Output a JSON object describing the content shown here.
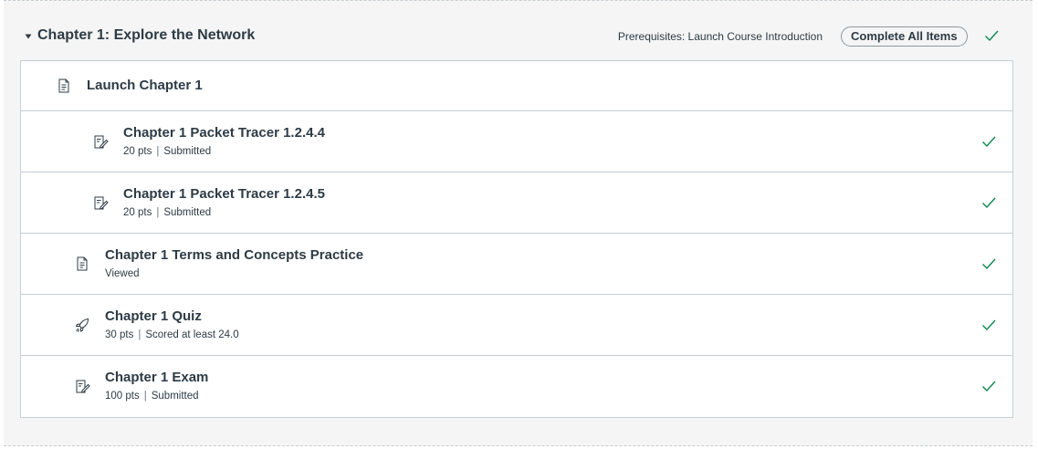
{
  "module": {
    "title": "Chapter 1: Explore the Network",
    "prerequisites": "Prerequisites: Launch Course Introduction",
    "complete_all_label": "Complete All Items",
    "completed": true,
    "accent_color": "#0b874b"
  },
  "items": [
    {
      "title": "Launch Chapter 1",
      "type": "page-icon",
      "indent": 0,
      "is_header": true
    },
    {
      "title": "Chapter 1 Packet Tracer 1.2.4.4",
      "type": "assignment-icon",
      "indent": 2,
      "points": "20 pts",
      "status": "Submitted",
      "completed": true
    },
    {
      "title": "Chapter 1 Packet Tracer 1.2.4.5",
      "type": "assignment-icon",
      "indent": 2,
      "points": "20 pts",
      "status": "Submitted",
      "completed": true
    },
    {
      "title": "Chapter 1 Terms and Concepts Practice",
      "type": "page-icon",
      "indent": 1,
      "points": "",
      "status": "Viewed",
      "completed": true
    },
    {
      "title": "Chapter 1 Quiz",
      "type": "quiz-rocket-icon",
      "indent": 1,
      "points": "30 pts",
      "status": "Scored at least 24.0",
      "completed": true
    },
    {
      "title": "Chapter 1 Exam",
      "type": "assignment-icon",
      "indent": 1,
      "points": "100 pts",
      "status": "Submitted",
      "completed": true
    }
  ]
}
